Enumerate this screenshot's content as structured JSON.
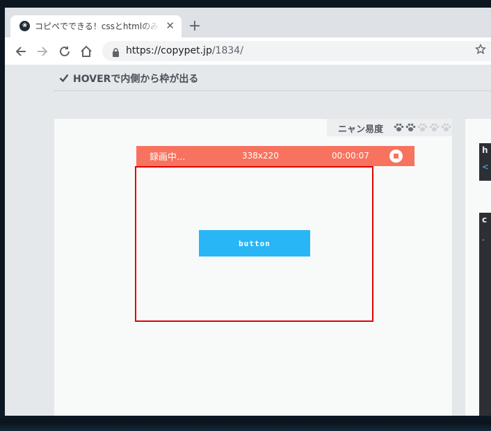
{
  "browser": {
    "tab": {
      "title": "コピペでできる！cssとhtmlのみで作る",
      "close": "✕"
    },
    "new_tab": "+",
    "url": {
      "host": "https://copypet.jp",
      "path": "/1834/"
    }
  },
  "page": {
    "heading": "HOVERで内側から枠が出る",
    "difficulty": {
      "label": "ニャン易度",
      "level": 2,
      "max": 5,
      "active_color": "#6b7075",
      "inactive_color": "#cdd1d4"
    },
    "recording": {
      "status": "録画中...",
      "size": "338x220",
      "time": "00:00:07",
      "bar_color": "#f7735f",
      "frame_color": "#e00000"
    },
    "demo": {
      "button_label": "button",
      "button_color": "#29b6f6"
    },
    "code_panels": [
      {
        "label": "h",
        "token": "<"
      },
      {
        "label": "c",
        "token": "."
      }
    ]
  }
}
